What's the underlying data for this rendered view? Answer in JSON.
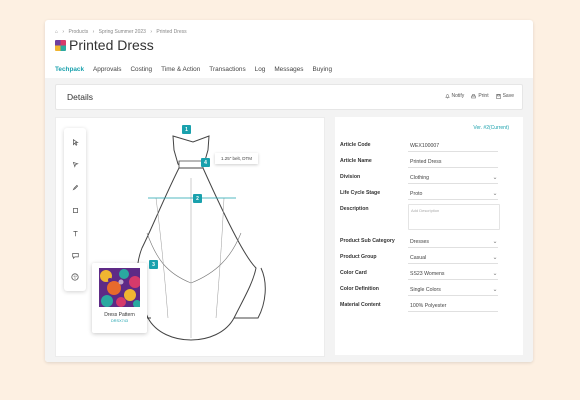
{
  "breadcrumb": [
    "Products",
    "Spring Summer 2023",
    "Printed Dress"
  ],
  "page_title": "Printed Dress",
  "tabs": [
    "Techpack",
    "Approvals",
    "Costing",
    "Time & Action",
    "Transactions",
    "Log",
    "Messages",
    "Buying"
  ],
  "active_tab": "Techpack",
  "details": {
    "title": "Details",
    "notify": "Notify",
    "print": "Print",
    "save": "Save"
  },
  "markers": {
    "m1": "1",
    "m2": "2",
    "m3": "3",
    "m4": "4",
    "callout": "1.25\" belt, DTM"
  },
  "pattern_card": {
    "name": "Dress Pattern",
    "sub": "DRSX743"
  },
  "form": {
    "version": "Ver. #2(Current)",
    "rows": [
      {
        "label": "Article Code",
        "value": "WEX100007",
        "dropdown": false
      },
      {
        "label": "Article Name",
        "value": "Printed Dress",
        "dropdown": false
      },
      {
        "label": "Division",
        "value": "Clothing",
        "dropdown": true
      },
      {
        "label": "Life Cycle Stage",
        "value": "Proto",
        "dropdown": true
      },
      {
        "label": "Description",
        "value": "",
        "placeholder": "Add Description",
        "dropdown": false
      },
      {
        "label": "Product Sub Category",
        "value": "Dresses",
        "dropdown": true
      },
      {
        "label": "Product Group",
        "value": "Casual",
        "dropdown": true
      },
      {
        "label": "Color Card",
        "value": "SS23 Womens",
        "dropdown": true
      },
      {
        "label": "Color Definition",
        "value": "Single Colors",
        "dropdown": true
      },
      {
        "label": "Material Content",
        "value": "100% Polyester",
        "dropdown": false
      }
    ]
  },
  "colors": {
    "accent": "#1aa1ad",
    "background": "#fdf0e2"
  },
  "icons": [
    "home-icon",
    "pointer-icon",
    "arrow-cursor-icon",
    "pencil-icon",
    "crop-icon",
    "text-icon",
    "comment-icon",
    "palette-icon",
    "bell-icon",
    "print-icon",
    "save-icon",
    "chevron-down-icon"
  ]
}
